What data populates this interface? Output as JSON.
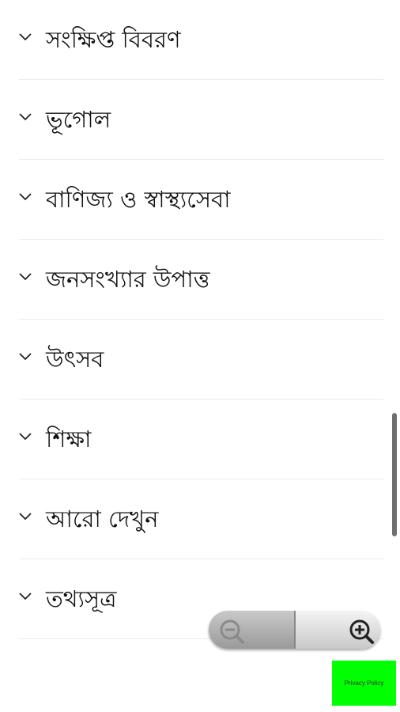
{
  "sections": [
    {
      "label": "সংক্ষিপ্ত বিবরণ",
      "icon": "chevron-down-icon"
    },
    {
      "label": "ভূগোল",
      "icon": "chevron-down-icon"
    },
    {
      "label": "বাণিজ্য ও স্বাস্থ্যসেবা",
      "icon": "chevron-down-icon"
    },
    {
      "label": "জনসংখ্যার উপাত্ত",
      "icon": "chevron-down-icon"
    },
    {
      "label": "উৎসব",
      "icon": "chevron-down-icon"
    },
    {
      "label": "শিক্ষা",
      "icon": "chevron-down-icon"
    },
    {
      "label": "আরো দেখুন",
      "icon": "chevron-down-icon"
    },
    {
      "label": "তথ্যসূত্র",
      "icon": "chevron-down-icon"
    }
  ],
  "zoom_controls": {
    "zoom_out_icon": "zoom-out-icon",
    "zoom_in_icon": "zoom-in-icon"
  },
  "privacy_button": {
    "label": "Privacy Policy",
    "color": "#00ff00"
  }
}
